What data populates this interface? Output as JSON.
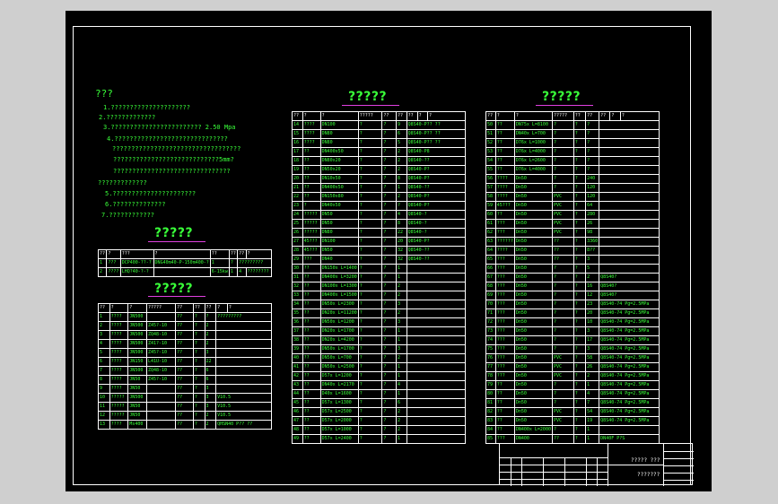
{
  "notes": {
    "heading": "???",
    "lines": [
      "1.?????????????????????",
      "2.?????????????",
      "3.????????????????????????      2.50  Mpa",
      "4.??????????????????????????????",
      "  ??????????????????????????????????",
      "  ????????????????????????????5mm?",
      "  ???????????????????????????????",
      "?????????????",
      "5.??????????????????????",
      "6.??????????????",
      "7.????????????"
    ]
  },
  "table1": {
    "title": "?????",
    "header": [
      "??",
      "?",
      "???",
      "?",
      "??",
      "??",
      "??",
      "?"
    ],
    "rows": [
      [
        "1",
        "???",
        "DCP400-??-?",
        "DNG40m40-P-150m400-?",
        "1",
        "?",
        "?????????"
      ],
      [
        "2",
        "????",
        "LHQ?40-?-?",
        "",
        "6-15kw",
        "1",
        "4",
        "????????"
      ]
    ]
  },
  "table2": {
    "title": "?????",
    "header": [
      "??",
      "?",
      "?",
      "?????",
      "??",
      "??",
      "??",
      "?",
      "?"
    ],
    "rows": [
      [
        "1",
        "????",
        "JN500",
        "",
        "??",
        "?",
        "?",
        "?????????"
      ],
      [
        "2",
        "????",
        "JN500",
        "Z45?-10",
        "??",
        "?",
        "2",
        ""
      ],
      [
        "3",
        "????",
        "JN500",
        "ZQ48-10",
        "??",
        "?",
        "2",
        ""
      ],
      [
        "4",
        "????",
        "JN500",
        "Z41?-10",
        "??",
        "?",
        "2",
        ""
      ],
      [
        "5",
        "????",
        "JN500",
        "Z45?-10",
        "??",
        "?",
        "3",
        ""
      ],
      [
        "6",
        "????",
        "JN150",
        "L41U-10",
        "??",
        "?",
        "22",
        ""
      ],
      [
        "7",
        "????",
        "JN500",
        "ZQ48-10",
        "??",
        "?",
        "6",
        ""
      ],
      [
        "8",
        "????",
        "JN50",
        "Z45?-10",
        "??",
        "?",
        "6",
        ""
      ],
      [
        "9",
        "????",
        "JN50",
        "",
        "??",
        "?",
        "3",
        ""
      ],
      [
        "10",
        "?????",
        "JN500",
        "",
        "??",
        "?",
        "3",
        "V10.5"
      ],
      [
        "11",
        "?????",
        "JN50",
        "",
        "??",
        "?",
        "3",
        "V10.5"
      ],
      [
        "12",
        "?????",
        "JN50",
        "",
        "??",
        "?",
        "2",
        "V10.5"
      ],
      [
        "13",
        "????",
        "Ms400",
        "",
        "??",
        "?",
        "2",
        "QHSN40 P??  ??"
      ]
    ]
  },
  "table3": {
    "title": "?????",
    "header": [
      "??",
      "?",
      "?",
      "?????",
      "??",
      "??",
      "??",
      "?",
      "?"
    ],
    "rows": [
      [
        "14",
        "????",
        "DN100",
        "?",
        "?",
        "9",
        "Q8S40-P??  ??"
      ],
      [
        "15",
        "????",
        "DN80",
        "?",
        "?",
        "6",
        "Q8S40-P??  ??"
      ],
      [
        "16",
        "????",
        "DN80",
        "?",
        "?",
        "5",
        "Q8S40-P??  ??"
      ],
      [
        "17",
        "??",
        "DN400x50",
        "?",
        "?",
        "2",
        "Q8S40-P8"
      ],
      [
        "18",
        "??",
        "DN80x20",
        "?",
        "?",
        "2",
        "Q8S40-??"
      ],
      [
        "19",
        "??",
        "DN50x20",
        "?",
        "?",
        "2",
        "Q8S40-P?"
      ],
      [
        "20",
        "??",
        "DN10x50",
        "?",
        "?",
        "8",
        "Q8S40-P?"
      ],
      [
        "21",
        "??",
        "DN400x50",
        "?",
        "?",
        "1",
        "Q8S40-??"
      ],
      [
        "22",
        "??",
        "DN150x80",
        "?",
        "?",
        "2",
        "Q8S40-P?"
      ],
      [
        "23",
        "?",
        "DN40x50",
        "?",
        "?",
        "?",
        "Q8S40-P?"
      ],
      [
        "24",
        "?????",
        "DN50",
        "?",
        "?",
        "4",
        "Q8S40-?"
      ],
      [
        "25",
        "?????",
        "DN50",
        "?",
        "?",
        "8",
        "Q8S40-?"
      ],
      [
        "26",
        "?????",
        "DN80",
        "?",
        "?",
        "22",
        "Q8S40-?"
      ],
      [
        "27",
        "45???",
        "DN100",
        "?",
        "?",
        "20",
        "Q8S40-P?"
      ],
      [
        "28",
        "45???",
        "DN50",
        "?",
        "?",
        "32",
        "Q8S40-??"
      ],
      [
        "29",
        "???",
        "DN40",
        "?",
        "?",
        "32",
        "Q8S40-??"
      ],
      [
        "30",
        "??",
        "DN150x L=1400",
        "?",
        "?",
        "1",
        ""
      ],
      [
        "31",
        "??",
        "DN400x L=3200",
        "?",
        "?",
        "1",
        ""
      ],
      [
        "32",
        "??",
        "DN100x L=1300",
        "?",
        "?",
        "2",
        ""
      ],
      [
        "33",
        "??",
        "DN400x L=1500",
        "?",
        "?",
        "2",
        ""
      ],
      [
        "34",
        "??",
        "DN50x L=2300",
        "?",
        "?",
        "3",
        ""
      ],
      [
        "35",
        "??",
        "DN20x L=11200",
        "?",
        "?",
        "2",
        ""
      ],
      [
        "36",
        "??",
        "DN50x L=1200",
        "?",
        "?",
        "3",
        ""
      ],
      [
        "37",
        "??",
        "DN20x L=1700",
        "?",
        "?",
        "1",
        ""
      ],
      [
        "38",
        "??",
        "DN20x L=4200",
        "?",
        "?",
        "1",
        ""
      ],
      [
        "39",
        "??",
        "DN50x L=1700",
        "?",
        "?",
        "3",
        ""
      ],
      [
        "40",
        "??",
        "DN50x L=700",
        "?",
        "?",
        "2",
        ""
      ],
      [
        "41",
        "??",
        "DN50x L=2500",
        "?",
        "?",
        "1",
        ""
      ],
      [
        "42",
        "??",
        "D57x L=1200",
        "?",
        "?",
        "1",
        ""
      ],
      [
        "43",
        "??",
        "DN40x L=2170",
        "?",
        "?",
        "4",
        ""
      ],
      [
        "44",
        "??",
        "D40x L=1600",
        "?",
        "?",
        "1",
        ""
      ],
      [
        "45",
        "??",
        "D57x L=1300",
        "?",
        "?",
        "6",
        ""
      ],
      [
        "46",
        "??",
        "D57x L=2500",
        "?",
        "?",
        "2",
        ""
      ],
      [
        "47",
        "??",
        "D57x L=2000",
        "?",
        "?",
        "2",
        ""
      ],
      [
        "48",
        "??",
        "D57x L=1000",
        "?",
        "?",
        "2",
        ""
      ],
      [
        "49",
        "??",
        "D57x L=2400",
        "?",
        "?",
        "1",
        ""
      ]
    ]
  },
  "table4": {
    "title": "?????",
    "header": [
      "??",
      "?",
      "?",
      "?????",
      "??",
      "??",
      "??",
      "?",
      "?"
    ],
    "rows": [
      [
        "50",
        "??",
        "DN75x L=8100",
        "?",
        "?",
        "?",
        ""
      ],
      [
        "51",
        "??",
        "DN40x L=700",
        "?",
        "?",
        "?",
        ""
      ],
      [
        "52",
        "??",
        "D76x L=1000",
        "?",
        "?",
        "?",
        ""
      ],
      [
        "53",
        "??",
        "D76x L=4000",
        "?",
        "?",
        "?",
        ""
      ],
      [
        "54",
        "??",
        "D76x L=2600",
        "?",
        "?",
        "?",
        ""
      ],
      [
        "55",
        "??",
        "D76x L=4000",
        "?",
        "?",
        "?",
        ""
      ],
      [
        "56",
        "????",
        "Dn50",
        "?",
        "?",
        "240",
        ""
      ],
      [
        "57",
        "????",
        "Dn50",
        "?",
        "?",
        "120",
        ""
      ],
      [
        "58",
        "????",
        "Dn50",
        "PVC",
        "?",
        "120",
        ""
      ],
      [
        "59",
        "45???",
        "Dn50",
        "PVC",
        "?",
        "64",
        ""
      ],
      [
        "60",
        "??",
        "Dn50",
        "PVC",
        "?",
        "280",
        ""
      ],
      [
        "61",
        "???",
        "Dn50",
        "PVC",
        "?",
        "26",
        ""
      ],
      [
        "62",
        "???",
        "Dn50",
        "PVC",
        "?",
        "98",
        ""
      ],
      [
        "63",
        "??????",
        "Dn50",
        "??",
        "?",
        "3360",
        ""
      ],
      [
        "64",
        "????",
        "Dn50",
        "??",
        "?",
        "8??",
        ""
      ],
      [
        "65",
        "???",
        "Dn50",
        "??",
        "?",
        "3",
        ""
      ],
      [
        "66",
        "???",
        "Dn50",
        "?",
        "?",
        "5",
        ""
      ],
      [
        "67",
        "???",
        "Dn50",
        "?",
        "?",
        "2",
        "Q8S40?"
      ],
      [
        "68",
        "???",
        "Dn50",
        "?",
        "?",
        "16",
        "Q8S40?"
      ],
      [
        "69",
        "???",
        "Dn50",
        "?",
        "?",
        "12",
        "Q8S40?"
      ],
      [
        "70",
        "???",
        "Dn50",
        "?",
        "?",
        "23",
        "Q8S40-74 Pg=2.5MPa"
      ],
      [
        "71",
        "???",
        "Dn50",
        "?",
        "?",
        "20",
        "Q8S40-74 Pg=2.5MPa"
      ],
      [
        "72",
        "???",
        "Dn50",
        "?",
        "?",
        "10",
        "Q8S40-74 Pg=2.5MPa"
      ],
      [
        "73",
        "???",
        "Dn50",
        "?",
        "?",
        "3",
        "Q8S40-74 Pg=2.5MPa"
      ],
      [
        "74",
        "???",
        "Dn50",
        "?",
        "?",
        "17",
        "Q8S40-74 Pg=2.5MPa"
      ],
      [
        "75",
        "???",
        "Dn50",
        "?",
        "?",
        "3",
        "Q8S40-74 Pg=2.5MPa"
      ],
      [
        "76",
        "???",
        "Dn50",
        "PVC",
        "?",
        "58",
        "Q8S40-74 Pg=2.5MPa"
      ],
      [
        "77",
        "???",
        "Dn50",
        "PVC",
        "?",
        "26",
        "Q8S40-74 Pg=2.5MPa"
      ],
      [
        "78",
        "???",
        "Dn50",
        "PVC",
        "?",
        "2",
        "Q8S40-74 Pg=2.5MPa"
      ],
      [
        "79",
        "??",
        "Dn50",
        "?",
        "?",
        "1",
        "Q8S40-74 Pg=2.5MPa"
      ],
      [
        "80",
        "??",
        "Dn50",
        "?",
        "?",
        "4",
        "Q8S40-74 Pg=2.5MPa"
      ],
      [
        "81",
        "??",
        "Dn50",
        "?",
        "?",
        "7",
        "Q8S40-74 Pg=2.5MPa"
      ],
      [
        "82",
        "??",
        "Dn50",
        "PVC",
        "?",
        "54",
        "Q8S40-74 Pg=2.5MPa"
      ],
      [
        "83",
        "??",
        "Dn50",
        "PVC",
        "?",
        "19",
        "Q8S40-74 Pg=2.5MPa"
      ],
      [
        "84",
        "??",
        "DN400x L=2000",
        "?",
        "?",
        "1",
        ""
      ],
      [
        "85",
        "???",
        "DN400",
        "??",
        "?",
        "1",
        "DN40F P?S"
      ]
    ]
  },
  "titleblock": {
    "stamp": "?????  ???",
    "name": "???????"
  }
}
